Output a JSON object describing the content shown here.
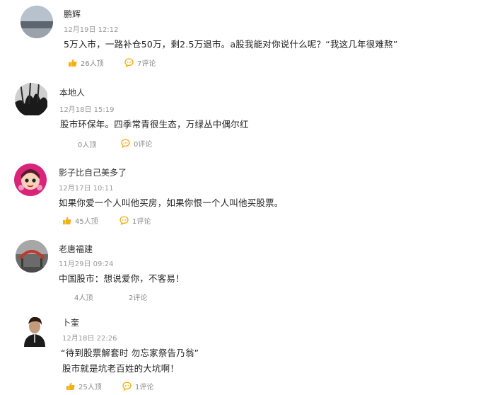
{
  "comments": [
    {
      "user": "鹏辉",
      "time": "12月19日 12:12",
      "lines": [
        "5万入市，一路补仓50万，剩2.5万退市。a股我能对你说什么呢？“我这几年很难熬”"
      ],
      "likes": "26人顶",
      "replies": "7评论"
    },
    {
      "user": "本地人",
      "time": "12月18日 15:19",
      "lines": [
        "股市环保年。四季常青很生态，万绿丛中偶尔红"
      ],
      "likes": "0人顶",
      "replies": "0评论"
    },
    {
      "user": "影子比自己美多了",
      "time": "12月17日 10:11",
      "lines": [
        "如果你爱一个人叫他买房，如果你恨一个人叫他买股票。"
      ],
      "likes": "45人顶",
      "replies": "1评论"
    },
    {
      "user": "老唐福建",
      "time": "11月29日 09:24",
      "lines": [
        "中国股市：想说爱你，不客易！"
      ],
      "likes": "4人顶",
      "replies": "2评论"
    },
    {
      "user": "卜奎",
      "time": "12月18日 22:26",
      "lines": [
        "“待到股票解套时 勿忘家祭告乃翁”",
        "股市就是坑老百姓的大坑啊！"
      ],
      "likes": "25人顶",
      "replies": "1评论"
    }
  ]
}
